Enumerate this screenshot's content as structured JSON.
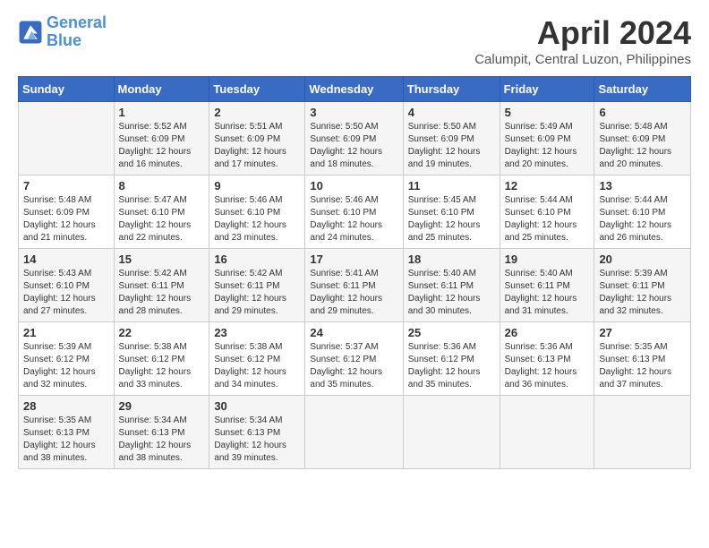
{
  "header": {
    "logo_line1": "General",
    "logo_line2": "Blue",
    "month": "April 2024",
    "location": "Calumpit, Central Luzon, Philippines"
  },
  "days_of_week": [
    "Sunday",
    "Monday",
    "Tuesday",
    "Wednesday",
    "Thursday",
    "Friday",
    "Saturday"
  ],
  "weeks": [
    [
      {
        "num": "",
        "info": ""
      },
      {
        "num": "1",
        "info": "Sunrise: 5:52 AM\nSunset: 6:09 PM\nDaylight: 12 hours\nand 16 minutes."
      },
      {
        "num": "2",
        "info": "Sunrise: 5:51 AM\nSunset: 6:09 PM\nDaylight: 12 hours\nand 17 minutes."
      },
      {
        "num": "3",
        "info": "Sunrise: 5:50 AM\nSunset: 6:09 PM\nDaylight: 12 hours\nand 18 minutes."
      },
      {
        "num": "4",
        "info": "Sunrise: 5:50 AM\nSunset: 6:09 PM\nDaylight: 12 hours\nand 19 minutes."
      },
      {
        "num": "5",
        "info": "Sunrise: 5:49 AM\nSunset: 6:09 PM\nDaylight: 12 hours\nand 20 minutes."
      },
      {
        "num": "6",
        "info": "Sunrise: 5:48 AM\nSunset: 6:09 PM\nDaylight: 12 hours\nand 20 minutes."
      }
    ],
    [
      {
        "num": "7",
        "info": "Sunrise: 5:48 AM\nSunset: 6:09 PM\nDaylight: 12 hours\nand 21 minutes."
      },
      {
        "num": "8",
        "info": "Sunrise: 5:47 AM\nSunset: 6:10 PM\nDaylight: 12 hours\nand 22 minutes."
      },
      {
        "num": "9",
        "info": "Sunrise: 5:46 AM\nSunset: 6:10 PM\nDaylight: 12 hours\nand 23 minutes."
      },
      {
        "num": "10",
        "info": "Sunrise: 5:46 AM\nSunset: 6:10 PM\nDaylight: 12 hours\nand 24 minutes."
      },
      {
        "num": "11",
        "info": "Sunrise: 5:45 AM\nSunset: 6:10 PM\nDaylight: 12 hours\nand 25 minutes."
      },
      {
        "num": "12",
        "info": "Sunrise: 5:44 AM\nSunset: 6:10 PM\nDaylight: 12 hours\nand 25 minutes."
      },
      {
        "num": "13",
        "info": "Sunrise: 5:44 AM\nSunset: 6:10 PM\nDaylight: 12 hours\nand 26 minutes."
      }
    ],
    [
      {
        "num": "14",
        "info": "Sunrise: 5:43 AM\nSunset: 6:10 PM\nDaylight: 12 hours\nand 27 minutes."
      },
      {
        "num": "15",
        "info": "Sunrise: 5:42 AM\nSunset: 6:11 PM\nDaylight: 12 hours\nand 28 minutes."
      },
      {
        "num": "16",
        "info": "Sunrise: 5:42 AM\nSunset: 6:11 PM\nDaylight: 12 hours\nand 29 minutes."
      },
      {
        "num": "17",
        "info": "Sunrise: 5:41 AM\nSunset: 6:11 PM\nDaylight: 12 hours\nand 29 minutes."
      },
      {
        "num": "18",
        "info": "Sunrise: 5:40 AM\nSunset: 6:11 PM\nDaylight: 12 hours\nand 30 minutes."
      },
      {
        "num": "19",
        "info": "Sunrise: 5:40 AM\nSunset: 6:11 PM\nDaylight: 12 hours\nand 31 minutes."
      },
      {
        "num": "20",
        "info": "Sunrise: 5:39 AM\nSunset: 6:11 PM\nDaylight: 12 hours\nand 32 minutes."
      }
    ],
    [
      {
        "num": "21",
        "info": "Sunrise: 5:39 AM\nSunset: 6:12 PM\nDaylight: 12 hours\nand 32 minutes."
      },
      {
        "num": "22",
        "info": "Sunrise: 5:38 AM\nSunset: 6:12 PM\nDaylight: 12 hours\nand 33 minutes."
      },
      {
        "num": "23",
        "info": "Sunrise: 5:38 AM\nSunset: 6:12 PM\nDaylight: 12 hours\nand 34 minutes."
      },
      {
        "num": "24",
        "info": "Sunrise: 5:37 AM\nSunset: 6:12 PM\nDaylight: 12 hours\nand 35 minutes."
      },
      {
        "num": "25",
        "info": "Sunrise: 5:36 AM\nSunset: 6:12 PM\nDaylight: 12 hours\nand 35 minutes."
      },
      {
        "num": "26",
        "info": "Sunrise: 5:36 AM\nSunset: 6:13 PM\nDaylight: 12 hours\nand 36 minutes."
      },
      {
        "num": "27",
        "info": "Sunrise: 5:35 AM\nSunset: 6:13 PM\nDaylight: 12 hours\nand 37 minutes."
      }
    ],
    [
      {
        "num": "28",
        "info": "Sunrise: 5:35 AM\nSunset: 6:13 PM\nDaylight: 12 hours\nand 38 minutes."
      },
      {
        "num": "29",
        "info": "Sunrise: 5:34 AM\nSunset: 6:13 PM\nDaylight: 12 hours\nand 38 minutes."
      },
      {
        "num": "30",
        "info": "Sunrise: 5:34 AM\nSunset: 6:13 PM\nDaylight: 12 hours\nand 39 minutes."
      },
      {
        "num": "",
        "info": ""
      },
      {
        "num": "",
        "info": ""
      },
      {
        "num": "",
        "info": ""
      },
      {
        "num": "",
        "info": ""
      }
    ]
  ]
}
